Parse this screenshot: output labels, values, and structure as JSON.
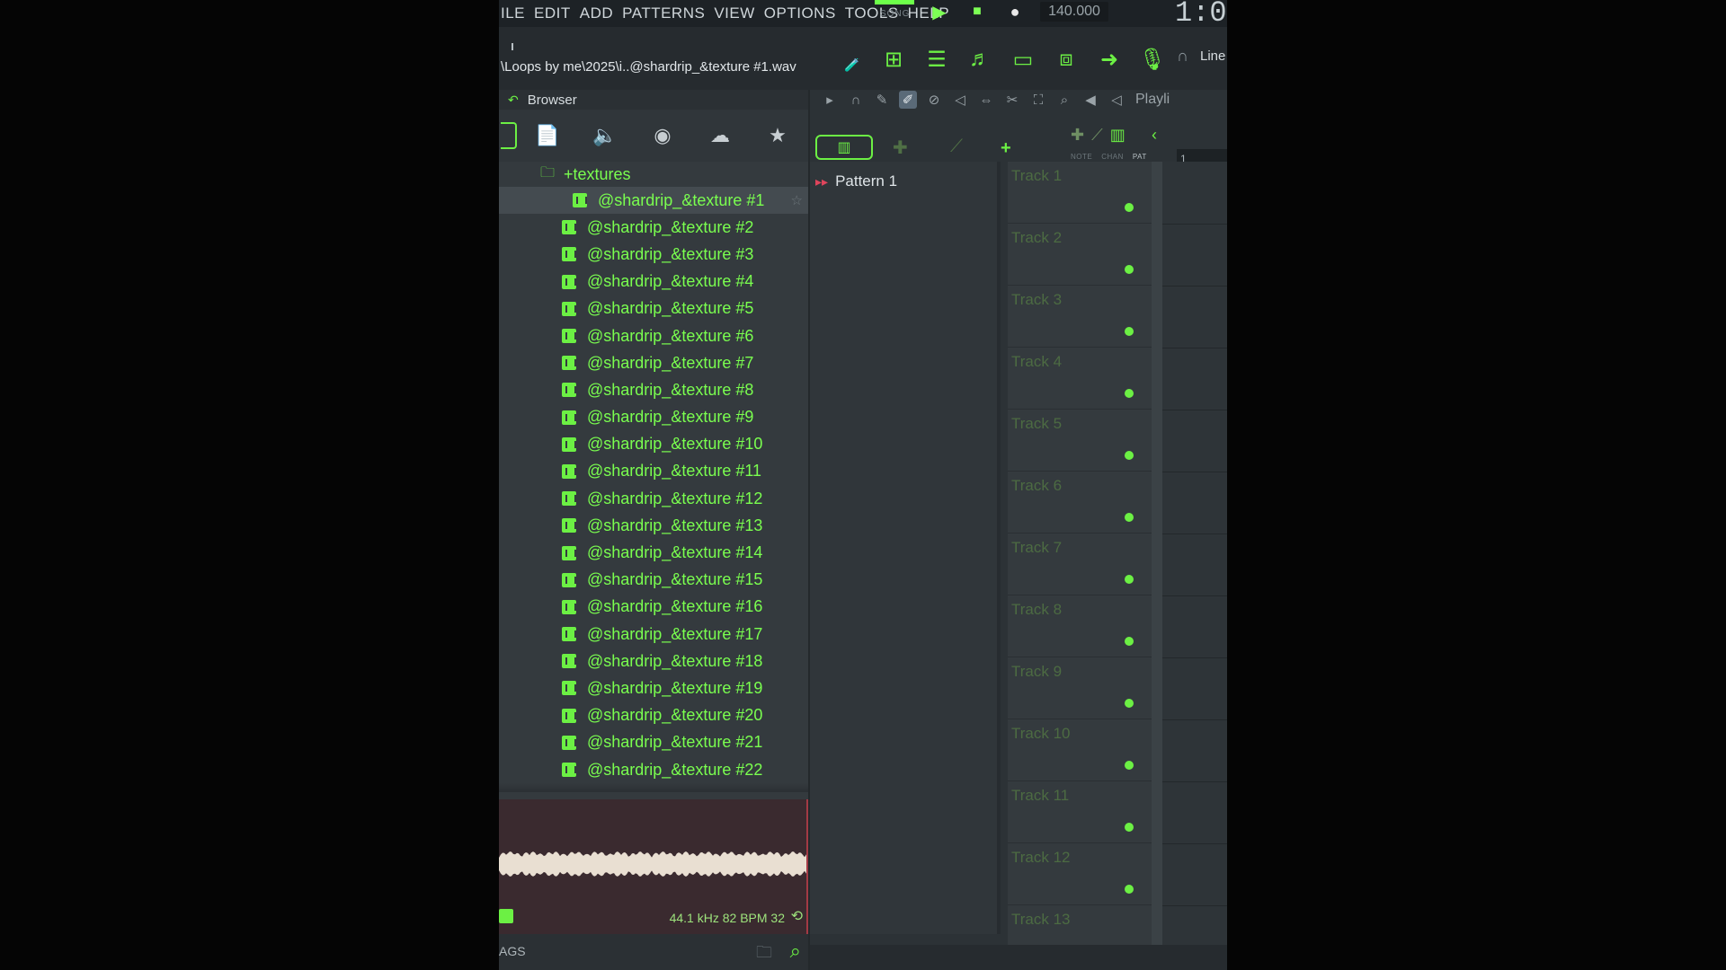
{
  "menu": [
    "ILE",
    "EDIT",
    "ADD",
    "PATTERNS",
    "VIEW",
    "OPTIONS",
    "TOOLS",
    "HELP"
  ],
  "transport": {
    "mode_label": "SONG",
    "tempo": "140.000",
    "time": "1:0"
  },
  "toolbar": {
    "file_path": "\\Loops by me\\2025\\i..@shardrip_&texture #1.wav",
    "line_label": "Line"
  },
  "browser": {
    "title": "Browser",
    "folder": "+textures",
    "selected_index": 0,
    "files": [
      "@shardrip_&texture #1",
      "@shardrip_&texture #2",
      "@shardrip_&texture #3",
      "@shardrip_&texture #4",
      "@shardrip_&texture #5",
      "@shardrip_&texture #6",
      "@shardrip_&texture #7",
      "@shardrip_&texture #8",
      "@shardrip_&texture #9",
      "@shardrip_&texture #10",
      "@shardrip_&texture #11",
      "@shardrip_&texture #12",
      "@shardrip_&texture #13",
      "@shardrip_&texture #14",
      "@shardrip_&texture #15",
      "@shardrip_&texture #16",
      "@shardrip_&texture #17",
      "@shardrip_&texture #18",
      "@shardrip_&texture #19",
      "@shardrip_&texture #20",
      "@shardrip_&texture #21",
      "@shardrip_&texture #22"
    ],
    "sample_info": "44.1 kHz 82 BPM 32",
    "tags_label": "AGS"
  },
  "playlist": {
    "label": "Playli",
    "pattern": "Pattern 1",
    "bar_number": "1",
    "mode_labels": [
      "NOTE",
      "CHAN",
      "PAT"
    ],
    "tracks": [
      "Track 1",
      "Track 2",
      "Track 3",
      "Track 4",
      "Track 5",
      "Track 6",
      "Track 7",
      "Track 8",
      "Track 9",
      "Track 10",
      "Track 11",
      "Track 12",
      "Track 13"
    ]
  },
  "colors": {
    "accent": "#6cf044",
    "file_text": "#7aff4f",
    "panel_bg": "#343a3e",
    "waveform_bg": "#3a2a2f"
  }
}
